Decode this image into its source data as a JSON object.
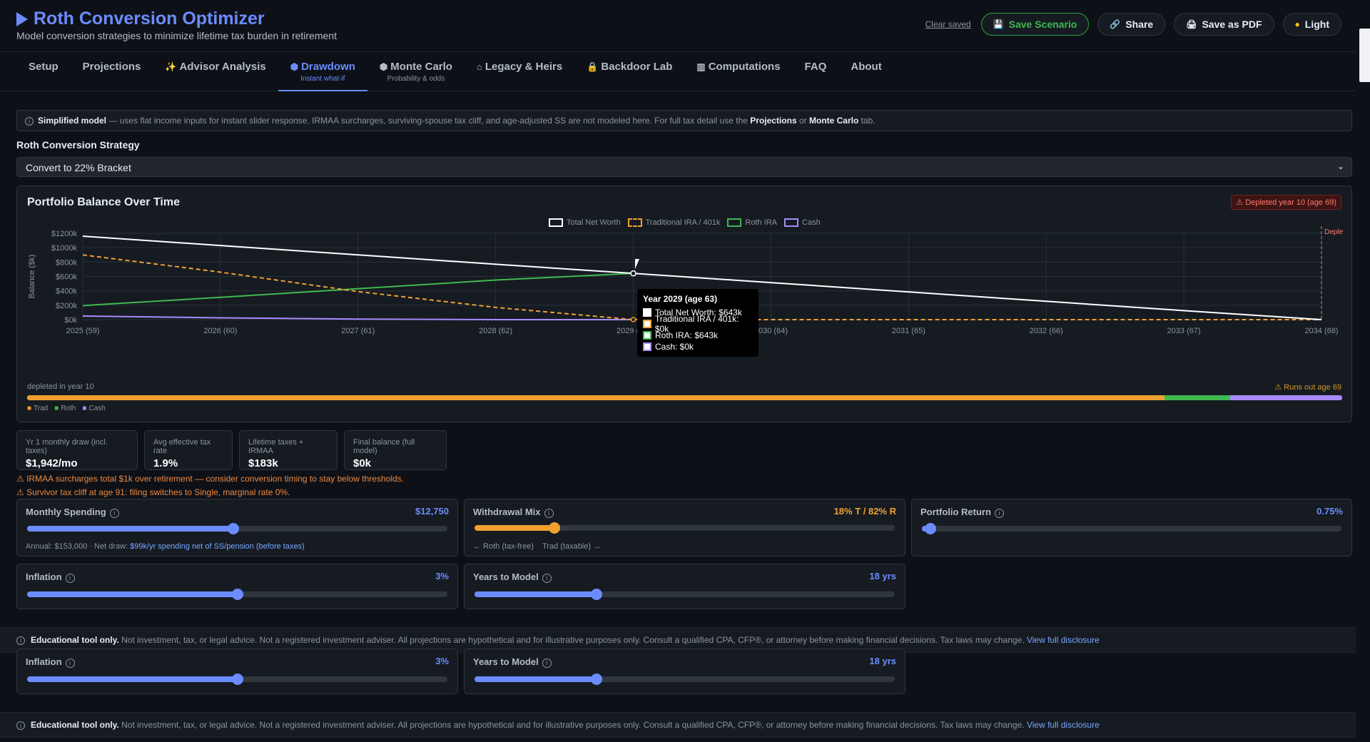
{
  "app": {
    "title": "Roth Conversion Optimizer",
    "subtitle": "Model conversion strategies to minimize lifetime tax burden in retirement"
  },
  "header": {
    "clear_saved": "Clear saved",
    "save_scenario": "Save Scenario",
    "share": "Share",
    "save_pdf": "Save as PDF",
    "theme": "Light"
  },
  "tabs": [
    {
      "label": "Setup",
      "sub": "",
      "icon": ""
    },
    {
      "label": "Projections",
      "sub": "",
      "icon": ""
    },
    {
      "label": "Advisor Analysis",
      "sub": "",
      "icon": "sparkle-icon"
    },
    {
      "label": "Drawdown",
      "sub": "Instant what-if",
      "icon": "cube-icon",
      "active": true
    },
    {
      "label": "Monte Carlo",
      "sub": "Probability & odds",
      "icon": "cube-icon"
    },
    {
      "label": "Legacy & Heirs",
      "sub": "",
      "icon": "house-icon"
    },
    {
      "label": "Backdoor Lab",
      "sub": "",
      "icon": "lock-icon"
    },
    {
      "label": "Computations",
      "sub": "",
      "icon": "bar-chart-icon"
    },
    {
      "label": "FAQ",
      "sub": "",
      "icon": ""
    },
    {
      "label": "About",
      "sub": "",
      "icon": ""
    }
  ],
  "notice": {
    "bold": "Simplified model",
    "text": " — uses flat income inputs for instant slider response. IRMAA surcharges, surviving-spouse tax cliff, and age-adjusted SS are not modeled here. For full tax detail use the ",
    "link1": "Projections",
    "or": " or ",
    "link2": "Monte Carlo",
    "tail": " tab."
  },
  "strategy": {
    "label": "Roth Conversion Strategy",
    "selected": "Convert to 22% Bracket"
  },
  "chart_card": {
    "title": "Portfolio Balance Over Time",
    "badge": "Depleted year 10 (age 69)",
    "depletion_marker_label": "Deple",
    "tooltip": {
      "title": "Year 2029  (age 63)",
      "rows": [
        "Total Net Worth: $643k",
        "Traditional IRA / 401k: $0k",
        "Roth IRA: $643k",
        "Cash: $0k"
      ]
    },
    "strip_left": "depleted in year 10",
    "strip_right": "Runs out age 69",
    "strip_legend": [
      "Trad",
      "Roth",
      "Cash"
    ],
    "strip_fractions": {
      "trad": 0.865,
      "roth": 0.05,
      "cash": 0.085
    }
  },
  "chart_data": {
    "type": "line",
    "title": "Portfolio Balance Over Time",
    "ylabel": "Balance ($k)",
    "xlabel": "",
    "categories": [
      "2025 (59)",
      "2026 (60)",
      "2027 (61)",
      "2028 (62)",
      "2029 (63)",
      "2030 (64)",
      "2031 (65)",
      "2032 (66)",
      "2033 (67)",
      "2034 (68)"
    ],
    "yticks": [
      "$0k",
      "$200k",
      "$400k",
      "$600k",
      "$800k",
      "$1000k",
      "$1200k"
    ],
    "ylim": [
      0,
      1200
    ],
    "legend_position": "top-center",
    "grid": true,
    "series": [
      {
        "name": "Total Net Worth",
        "color": "#ffffff",
        "dashed": false,
        "values": [
          1160,
          1030,
          900,
          770,
          643,
          515,
          385,
          255,
          125,
          0
        ]
      },
      {
        "name": "Traditional IRA / 401k",
        "color": "#f0a030",
        "dashed": true,
        "values": [
          900,
          660,
          390,
          170,
          0,
          0,
          0,
          0,
          0,
          0
        ]
      },
      {
        "name": "Roth IRA",
        "color": "#3fb950",
        "dashed": false,
        "values": [
          195,
          310,
          430,
          550,
          643,
          null,
          null,
          null,
          null,
          null
        ]
      },
      {
        "name": "Cash",
        "color": "#a78bfa",
        "dashed": false,
        "values": [
          50,
          25,
          8,
          0,
          0,
          null,
          null,
          null,
          null,
          null
        ]
      }
    ]
  },
  "metrics": [
    {
      "label": "Yr 1 monthly draw (incl. taxes)",
      "value": "$1,942/mo"
    },
    {
      "label": "Avg effective tax rate",
      "value": "1.9%"
    },
    {
      "label": "Lifetime taxes + IRMAA",
      "value": "$183k"
    },
    {
      "label": "Final balance (full model)",
      "value": "$0k"
    }
  ],
  "warnings": [
    "⚠ IRMAA surcharges total $1k over retirement — consider conversion timing to stay below thresholds.",
    "⚠ Survivor tax cliff at age 91: filing switches to Single, marginal rate 0%."
  ],
  "controls": {
    "monthly_spending": {
      "label": "Monthly Spending",
      "value": "$12,750",
      "level": 0.49,
      "note_prefix": "Annual: $153,000  ·  Net draw: ",
      "note_link": "$99k/yr spending net of SS/pension (before taxes)"
    },
    "withdrawal_mix": {
      "label": "Withdrawal Mix",
      "value": "18% T / 82% R",
      "level": 0.19,
      "left_hint": "← Roth (tax-free)",
      "right_hint": "Trad (taxable) →"
    },
    "portfolio_return": {
      "label": "Portfolio Return",
      "value": "0.75%",
      "level": 0.02
    },
    "inflation": {
      "label": "Inflation",
      "value": "3%",
      "level": 0.5
    },
    "years_to_model": {
      "label": "Years to Model",
      "value": "18 yrs",
      "level": 0.29
    }
  },
  "disclaimer": {
    "bold": "Educational tool only.",
    "text": " Not investment, tax, or legal advice. Not a registered investment adviser. All projections are hypothetical and for illustrative purposes only. Consult a qualified CPA, CFP®, or attorney before making financial decisions. Tax laws may change.",
    "link": "View full disclosure"
  },
  "colors": {
    "accent": "#6b8cff",
    "trad": "#f0a030",
    "roth": "#3fb950",
    "cash": "#a78bfa",
    "danger": "#ff7b72"
  }
}
